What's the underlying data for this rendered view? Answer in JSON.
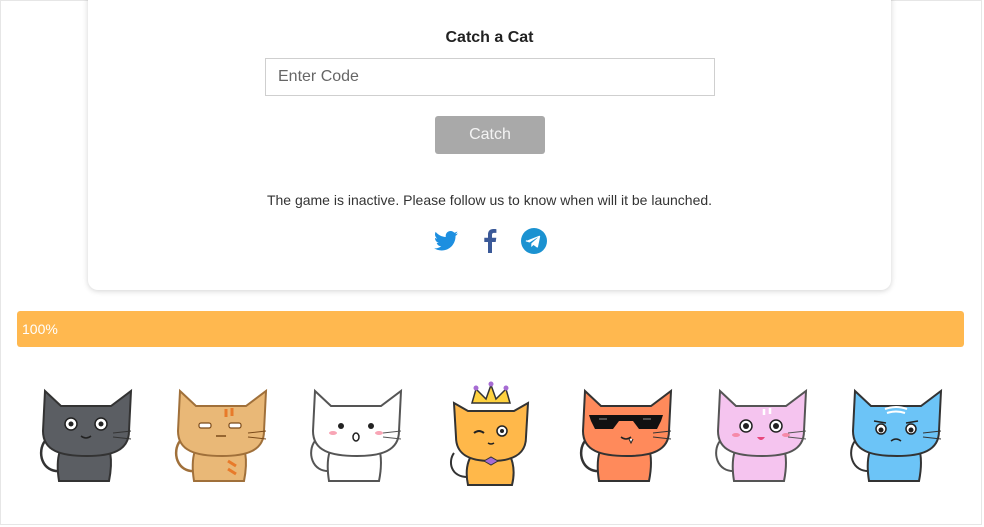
{
  "game": {
    "title": "Catch a Cat",
    "code_placeholder": "Enter Code",
    "code_value": "",
    "catch_label": "Catch",
    "status_text": "The game is inactive. Please follow us to know when will it be launched."
  },
  "socials": [
    {
      "name": "twitter",
      "icon": "twitter-icon",
      "color": "#1d8fe0"
    },
    {
      "name": "facebook",
      "icon": "facebook-icon",
      "color": "#3b5998"
    },
    {
      "name": "telegram",
      "icon": "telegram-icon",
      "color": "#1b92d1"
    }
  ],
  "progress": {
    "value": 1.0,
    "label": "100%",
    "color": "#ffb84f"
  },
  "cats": [
    {
      "name": "gray-cat",
      "color": "#5b5e63",
      "accessory": "none"
    },
    {
      "name": "tabby-cat",
      "color": "#e9b877",
      "accessory": "stripes"
    },
    {
      "name": "white-cat",
      "color": "#ffffff",
      "accessory": "blush"
    },
    {
      "name": "king-cat",
      "color": "#ffb84a",
      "accessory": "crown"
    },
    {
      "name": "cool-cat",
      "color": "#ff8a5b",
      "accessory": "sunglasses"
    },
    {
      "name": "pink-cat",
      "color": "#f5c4ef",
      "accessory": "blush"
    },
    {
      "name": "blue-cat",
      "color": "#6cc4f7",
      "accessory": "none"
    }
  ]
}
